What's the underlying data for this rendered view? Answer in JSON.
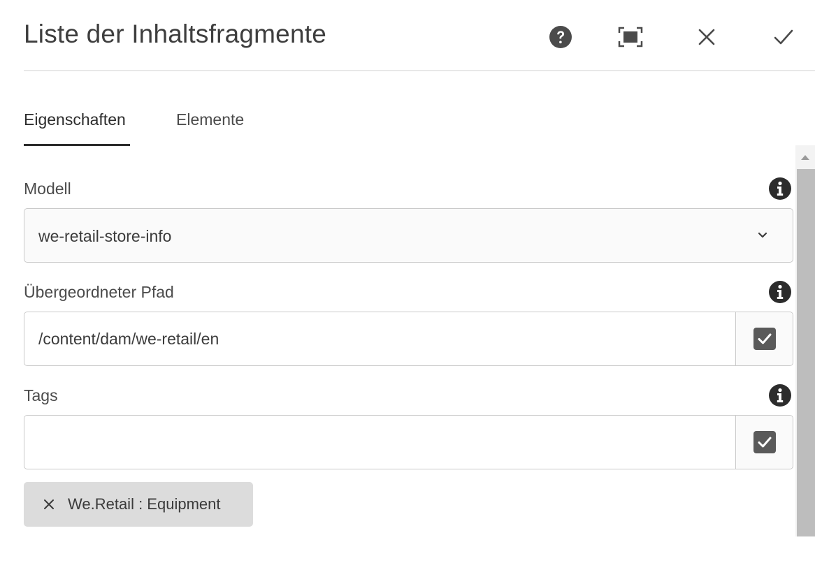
{
  "header": {
    "title": "Liste der Inhaltsfragmente",
    "help_icon": "help-circle-icon",
    "fullscreen_icon": "fullscreen-icon",
    "close_icon": "close-icon",
    "done_icon": "checkmark-icon"
  },
  "tabs": [
    {
      "label": "Eigenschaften",
      "active": true
    },
    {
      "label": "Elemente",
      "active": false
    }
  ],
  "form": {
    "model": {
      "label": "Modell",
      "value": "we-retail-store-info",
      "info_icon": "info-icon",
      "dropdown_icon": "chevron-down-icon"
    },
    "parent_path": {
      "label": "Übergeordneter Pfad",
      "value": "/content/dam/we-retail/en",
      "info_icon": "info-icon",
      "picker_icon": "select-checkbox-icon"
    },
    "tags": {
      "label": "Tags",
      "value": "",
      "info_icon": "info-icon",
      "picker_icon": "select-checkbox-icon",
      "selected": [
        {
          "label": "We.Retail : Equipment",
          "remove_icon": "close-icon"
        }
      ]
    }
  },
  "colors": {
    "text": "#4b4b4b",
    "active_tab_underline": "#2c2c2c",
    "field_border": "#cacaca",
    "tag_chip_bg": "#dcdcdc",
    "scrollbar_thumb": "#bdbdbd"
  }
}
